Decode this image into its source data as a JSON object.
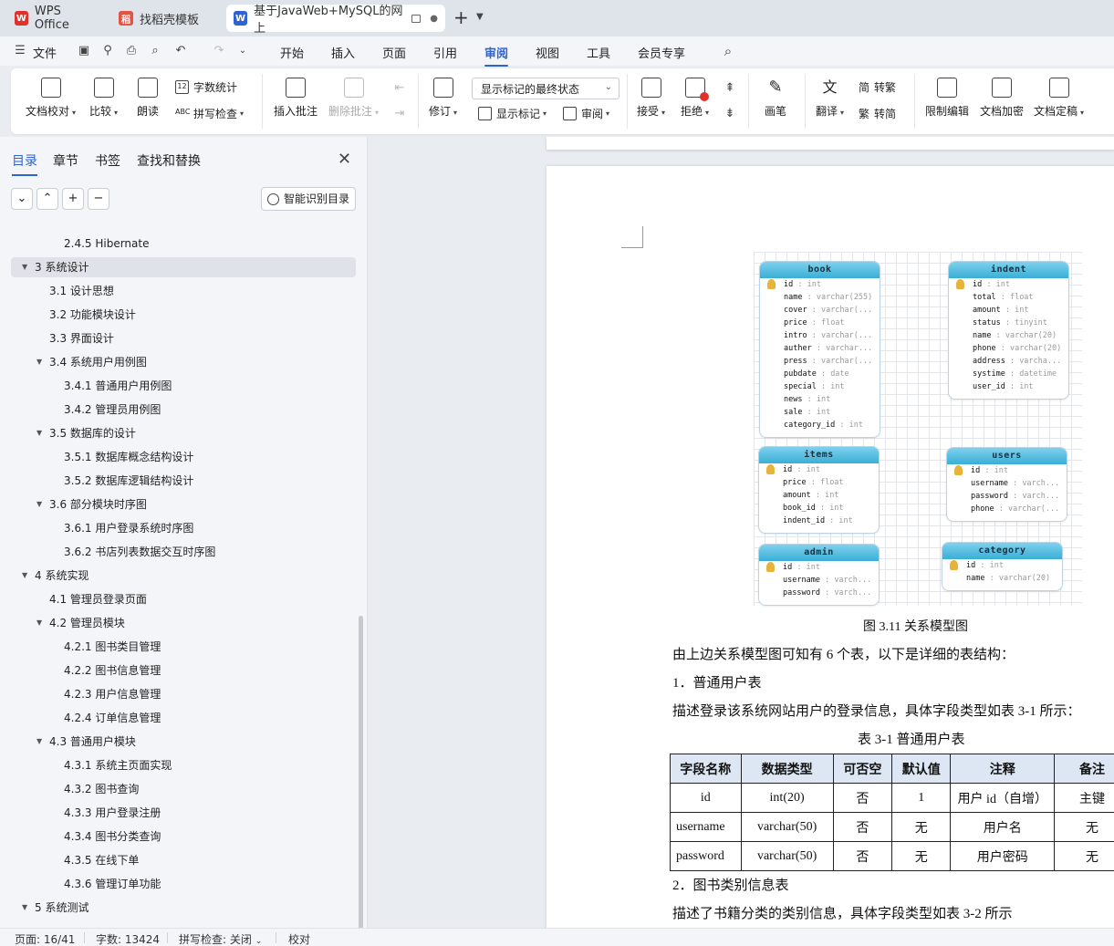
{
  "tabs": [
    {
      "label": "WPS Office",
      "icon": "wps-logo-icon"
    },
    {
      "label": "找稻壳模板",
      "icon": "docer-icon"
    },
    {
      "label": "基于JavaWeb+MySQL的网上",
      "icon": "word-doc-icon"
    }
  ],
  "menu": {
    "file": "文件",
    "items": [
      "开始",
      "插入",
      "页面",
      "引用",
      "审阅",
      "视图",
      "工具",
      "会员专享"
    ],
    "active": "审阅"
  },
  "ribbon": {
    "doc_check": "文档校对",
    "compare": "比较",
    "read_aloud": "朗读",
    "word_count": "字数统计",
    "spell_check": "拼写检查",
    "insert_comment": "插入批注",
    "delete_comment": "删除批注",
    "track_changes": "修订",
    "markup_state": "显示标记的最终状态",
    "show_markup": "显示标记",
    "review": "审阅",
    "accept": "接受",
    "reject": "拒绝",
    "pen": "画笔",
    "translate": "翻译",
    "to_traditional": "转繁",
    "to_simplified": "转简",
    "restrict_edit": "限制编辑",
    "doc_encrypt": "文档加密",
    "doc_finalize": "文档定稿"
  },
  "sidepanel": {
    "tabs": [
      "目录",
      "章节",
      "书签",
      "查找和替换"
    ],
    "smart_toc": "智能识别目录",
    "toc": [
      {
        "text": "2.4.5 Hibernate",
        "level": 3
      },
      {
        "text": "3  系统设计",
        "level": 1,
        "expanded": true,
        "selected": true
      },
      {
        "text": "3.1  设计思想",
        "level": 2
      },
      {
        "text": "3.2  功能模块设计",
        "level": 2
      },
      {
        "text": "3.3  界面设计",
        "level": 2
      },
      {
        "text": "3.4  系统用户用例图",
        "level": 2,
        "expanded": true
      },
      {
        "text": "3.4.1  普通用户用例图",
        "level": 3
      },
      {
        "text": "3.4.2  管理员用例图",
        "level": 3
      },
      {
        "text": "3.5  数据库的设计",
        "level": 2,
        "expanded": true
      },
      {
        "text": "3.5.1  数据库概念结构设计",
        "level": 3
      },
      {
        "text": "3.5.2  数据库逻辑结构设计",
        "level": 3
      },
      {
        "text": "3.6  部分模块时序图",
        "level": 2,
        "expanded": true
      },
      {
        "text": "3.6.1  用户登录系统时序图",
        "level": 3
      },
      {
        "text": "3.6.2  书店列表数据交互时序图",
        "level": 3
      },
      {
        "text": "4  系统实现",
        "level": 1,
        "expanded": true
      },
      {
        "text": "4.1  管理员登录页面",
        "level": 2
      },
      {
        "text": "4.2  管理员模块",
        "level": 2,
        "expanded": true
      },
      {
        "text": "4.2.1  图书类目管理",
        "level": 3
      },
      {
        "text": "4.2.2  图书信息管理",
        "level": 3
      },
      {
        "text": "4.2.3  用户信息管理",
        "level": 3
      },
      {
        "text": "4.2.4  订单信息管理",
        "level": 3
      },
      {
        "text": "4.3  普通用户模块",
        "level": 2,
        "expanded": true
      },
      {
        "text": "4.3.1  系统主页面实现",
        "level": 3
      },
      {
        "text": "4.3.2  图书查询",
        "level": 3
      },
      {
        "text": "4.3.3  用户登录注册",
        "level": 3
      },
      {
        "text": "4.3.4  图书分类查询",
        "level": 3
      },
      {
        "text": "4.3.5  在线下单",
        "level": 3
      },
      {
        "text": "4.3.6  管理订单功能",
        "level": 3
      },
      {
        "text": "5  系统测试",
        "level": 1,
        "expanded": true
      }
    ]
  },
  "er": {
    "book": {
      "title": "book",
      "fields": [
        {
          "name": "id",
          "type": "int",
          "key": true
        },
        {
          "name": "name",
          "type": "varchar(255)"
        },
        {
          "name": "cover",
          "type": "varchar(..."
        },
        {
          "name": "price",
          "type": "float"
        },
        {
          "name": "intro",
          "type": "varchar(..."
        },
        {
          "name": "auther",
          "type": "varchar..."
        },
        {
          "name": "press",
          "type": "varchar(..."
        },
        {
          "name": "pubdate",
          "type": "date"
        },
        {
          "name": "special",
          "type": "int"
        },
        {
          "name": "news",
          "type": "int"
        },
        {
          "name": "sale",
          "type": "int"
        },
        {
          "name": "category_id",
          "type": "int"
        }
      ]
    },
    "indent": {
      "title": "indent",
      "fields": [
        {
          "name": "id",
          "type": "int",
          "key": true
        },
        {
          "name": "total",
          "type": "float"
        },
        {
          "name": "amount",
          "type": "int"
        },
        {
          "name": "status",
          "type": "tinyint"
        },
        {
          "name": "name",
          "type": "varchar(20)"
        },
        {
          "name": "phone",
          "type": "varchar(20)"
        },
        {
          "name": "address",
          "type": "varcha..."
        },
        {
          "name": "systime",
          "type": "datetime"
        },
        {
          "name": "user_id",
          "type": "int"
        }
      ]
    },
    "items": {
      "title": "items",
      "fields": [
        {
          "name": "id",
          "type": "int",
          "key": true
        },
        {
          "name": "price",
          "type": "float"
        },
        {
          "name": "amount",
          "type": "int"
        },
        {
          "name": "book_id",
          "type": "int"
        },
        {
          "name": "indent_id",
          "type": "int"
        }
      ]
    },
    "users": {
      "title": "users",
      "fields": [
        {
          "name": "id",
          "type": "int",
          "key": true
        },
        {
          "name": "username",
          "type": "varch..."
        },
        {
          "name": "password",
          "type": "varch..."
        },
        {
          "name": "phone",
          "type": "varchar(..."
        }
      ]
    },
    "admin": {
      "title": "admin",
      "fields": [
        {
          "name": "id",
          "type": "int",
          "key": true
        },
        {
          "name": "username",
          "type": "varch..."
        },
        {
          "name": "password",
          "type": "varch..."
        }
      ]
    },
    "category": {
      "title": "category",
      "fields": [
        {
          "name": "id",
          "type": "int",
          "key": true
        },
        {
          "name": "name",
          "type": "varchar(20)"
        }
      ]
    }
  },
  "document": {
    "figure_caption": "图 3.11  关系模型图",
    "para1": "由上边关系模型图可知有 6 个表，以下是详细的表结构：",
    "para2": "1．普通用户表",
    "para3": "描述登录该系统网站用户的登录信息，具体字段类型如表 3-1 所示：",
    "table_caption": "表 3-1  普通用户表",
    "table_headers": [
      "字段名称",
      "数据类型",
      "可否空",
      "默认值",
      "注释",
      "备注"
    ],
    "table_rows": [
      [
        "id",
        "int(20)",
        "否",
        "1",
        "用户 id（自增）",
        "主键"
      ],
      [
        "username",
        "varchar(50)",
        "否",
        "无",
        "用户名",
        "无"
      ],
      [
        "password",
        "varchar(50)",
        "否",
        "无",
        "用户密码",
        "无"
      ]
    ],
    "para4": "2．图书类别信息表",
    "para5": "描述了书籍分类的类别信息，具体字段类型如表 3-2 所示"
  },
  "status": {
    "page": "页面: 16/41",
    "words": "字数: 13424",
    "spell": "拼写检查: 关闭",
    "proof": "校对"
  },
  "colors": {
    "accent": "#2e63d3",
    "er_header": "#3aaed6",
    "table_header": "#dde6f3"
  }
}
